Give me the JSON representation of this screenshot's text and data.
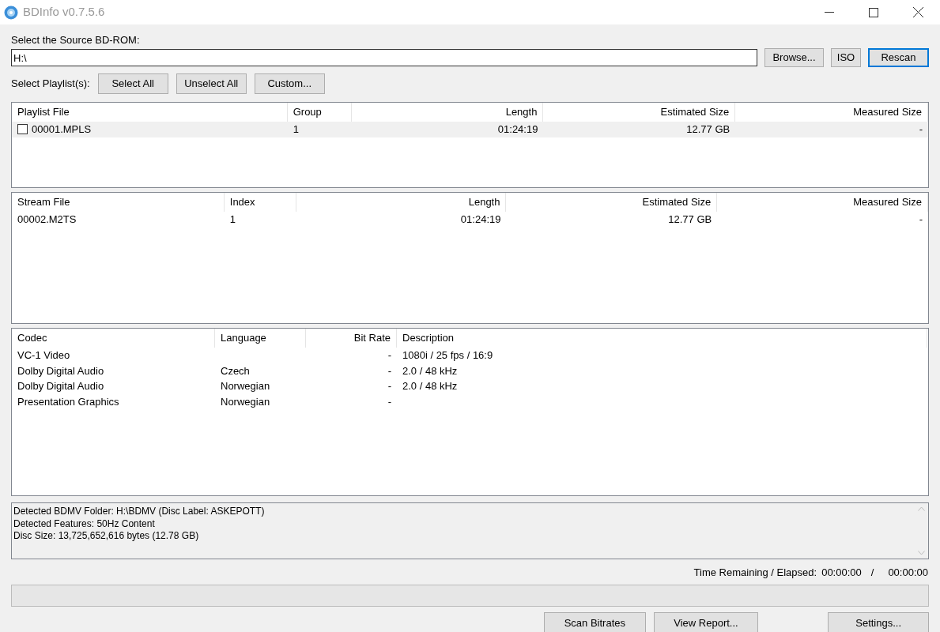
{
  "window": {
    "title": "BDInfo v0.7.5.6"
  },
  "source": {
    "label": "Select the Source BD-ROM:",
    "value": "H:\\",
    "buttons": [
      {
        "label": "Browse...",
        "focused": false
      },
      {
        "label": "ISO",
        "focused": false
      },
      {
        "label": "Rescan",
        "focused": true
      }
    ]
  },
  "playlist_select": {
    "label": "Select Playlist(s):",
    "buttons": [
      "Select All",
      "Unselect All",
      "Custom..."
    ]
  },
  "playlists": {
    "columns": [
      "Playlist File",
      "Group",
      "Length",
      "Estimated Size",
      "Measured Size"
    ],
    "rows": [
      {
        "cells": [
          "00001.MPLS",
          "1",
          "01:24:19",
          "12.77 GB",
          "-"
        ],
        "checked": false,
        "selected": true
      }
    ]
  },
  "streams": {
    "columns": [
      "Stream File",
      "Index",
      "Length",
      "Estimated Size",
      "Measured Size"
    ],
    "rows": [
      {
        "cells": [
          "00002.M2TS",
          "1",
          "01:24:19",
          "12.77 GB",
          "-"
        ],
        "selected": false
      }
    ]
  },
  "codecs": {
    "columns": [
      "Codec",
      "Language",
      "Bit Rate",
      "Description"
    ],
    "rows": [
      {
        "cells": [
          "VC-1 Video",
          "",
          "-",
          "1080i / 25 fps / 16:9"
        ],
        "selected": false
      },
      {
        "cells": [
          "Dolby Digital Audio",
          "Czech",
          "-",
          "2.0 / 48 kHz"
        ],
        "selected": false
      },
      {
        "cells": [
          "Dolby Digital Audio",
          "Norwegian",
          "-",
          "2.0 / 48 kHz"
        ],
        "selected": false
      },
      {
        "cells": [
          "Presentation Graphics",
          "Norwegian",
          "-",
          ""
        ],
        "selected": false
      }
    ]
  },
  "log": [
    "Detected BDMV Folder: H:\\BDMV (Disc Label: ASKEPOTT)",
    "Detected Features: 50Hz Content",
    "Disc Size: 13,725,652,616 bytes (12.78 GB)"
  ],
  "time": {
    "label": "Time Remaining / Elapsed:",
    "remaining": "00:00:00",
    "separator": "/",
    "elapsed": "00:00:00"
  },
  "progress": {
    "level": 0
  },
  "bottom_buttons": [
    "Scan Bitrates",
    "View Report...",
    "Settings..."
  ]
}
